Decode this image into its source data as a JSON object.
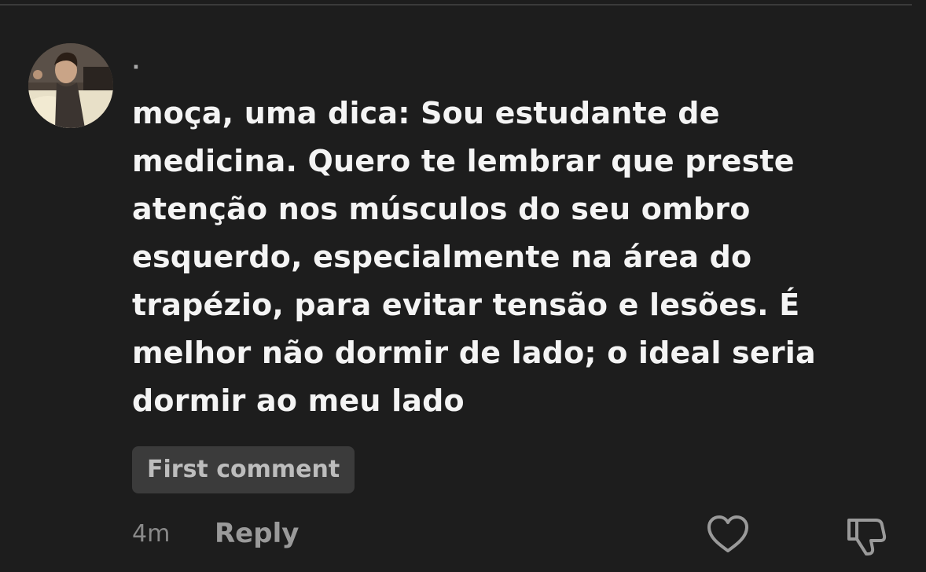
{
  "comment": {
    "username": "·",
    "text": "moça, uma dica: Sou estudante de medicina. Quero te lembrar que preste atenção nos músculos do seu ombro esquerdo, especialmente na área do trapézio, para evitar tensão e lesões. É melhor não dormir de lado; o ideal seria dormir ao meu lado",
    "text_lines": [
      "moça, uma dica: Sou estudante de",
      "medicina. Quero te lembrar que preste",
      "atenção nos músculos do seu ombro",
      "esquerdo, especialmente na área do",
      "trapézio, para evitar tensão e lesões. É",
      "melhor não dormir de lado; o ideal seria",
      "dormir ao meu lado"
    ],
    "badge": "First comment",
    "timestamp": "4m",
    "reply_label": "Reply"
  },
  "icons": {
    "like": "heart-icon",
    "dislike": "thumbs-down-icon"
  },
  "colors": {
    "background": "#1d1d1d",
    "text": "#f4f4f4",
    "muted": "#8a8a8a",
    "badge_bg": "#3b3b3b"
  }
}
